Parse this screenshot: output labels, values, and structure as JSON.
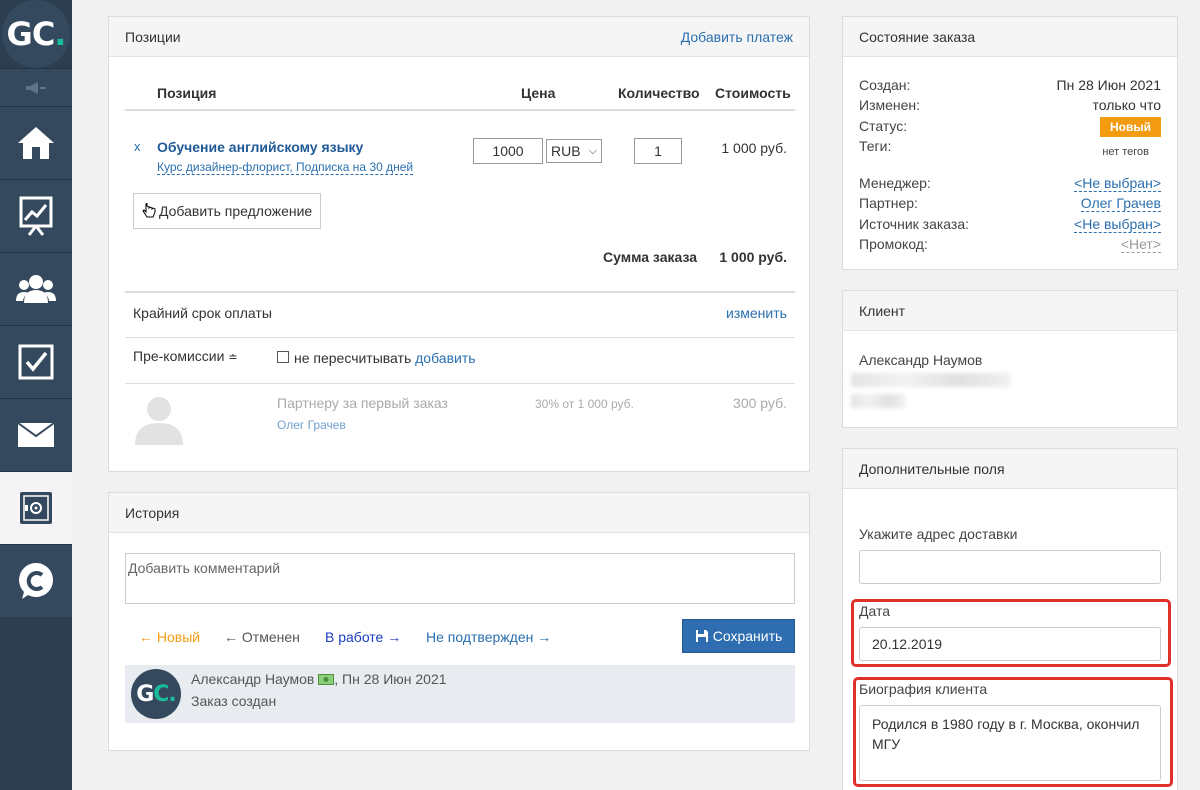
{
  "positions": {
    "title": "Позиции",
    "add_payment": "Добавить платеж",
    "headers": {
      "position": "Позиция",
      "price": "Цена",
      "qty": "Количество",
      "cost": "Стоимость"
    },
    "item": {
      "remove": "x",
      "title": "Обучение английскому языку",
      "subtitle": "Курс дизайнер-флорист, Подписка на 30 дней",
      "price": "1000",
      "currency": "RUB",
      "qty": "1",
      "cost": "1 000 руб."
    },
    "add_offer": "Добавить предложение",
    "total_label": "Сумма заказа",
    "total_value": "1 000 руб.",
    "deadline_label": "Крайний срок оплаты",
    "deadline_link": "изменить",
    "precom_label": "Пре-комиссии",
    "precom_icon": "≐",
    "no_recalc": "не пересчитывать",
    "add_link": "добавить",
    "partner_text": "Партнеру за первый заказ",
    "partner_pct": "30% от 1 000 руб.",
    "partner_sum": "300 руб.",
    "partner_name": "Олег Грачев"
  },
  "history": {
    "title": "История",
    "comment_placeholder": "Добавить комментарий",
    "statuses": [
      {
        "label": "← Новый",
        "color": "#f39c12"
      },
      {
        "label": "← Отменен",
        "color": "#555555"
      },
      {
        "label": "В работе →",
        "color": "#1a3ec0"
      },
      {
        "label": "Не подтвержден →",
        "color": "#2a6fb0"
      }
    ],
    "save": "Сохранить",
    "entry": {
      "author": "Александр Наумов",
      "date": ", Пн 28 Июн 2021",
      "text": "Заказ создан"
    }
  },
  "order_state": {
    "title": "Состояние заказа",
    "created_label": "Создан:",
    "created": "Пн 28 Июн 2021",
    "modified_label": "Изменен:",
    "modified": "только что",
    "status_label": "Статус:",
    "status": "Новый",
    "tags_label": "Теги:",
    "tags": "нет тегов",
    "manager_label": "Менеджер:",
    "manager": "<Не выбран>",
    "partner_label": "Партнер:",
    "partner": "Олег Грачев",
    "source_label": "Источник заказа:",
    "source": "<Не выбран>",
    "promo_label": "Промокод:",
    "promo": "<Нет>"
  },
  "client": {
    "title": "Клиент",
    "name": "Александр Наумов"
  },
  "extra_fields": {
    "title": "Дополнительные поля",
    "address_label": "Укажите адрес доставки",
    "address_value": "",
    "date_label": "Дата",
    "date_value": "20.12.2019",
    "bio_label": "Биография клиента",
    "bio_value": "Родился в 1980 году в г. Москва, окончил МГУ"
  },
  "brand": {
    "logo_text": "GC",
    "logo_dot": "."
  },
  "colors": {
    "accent": "#2a6fb0",
    "sidebar": "#2c3e50",
    "badge": "#f39c12",
    "highlight": "#e0302a"
  }
}
